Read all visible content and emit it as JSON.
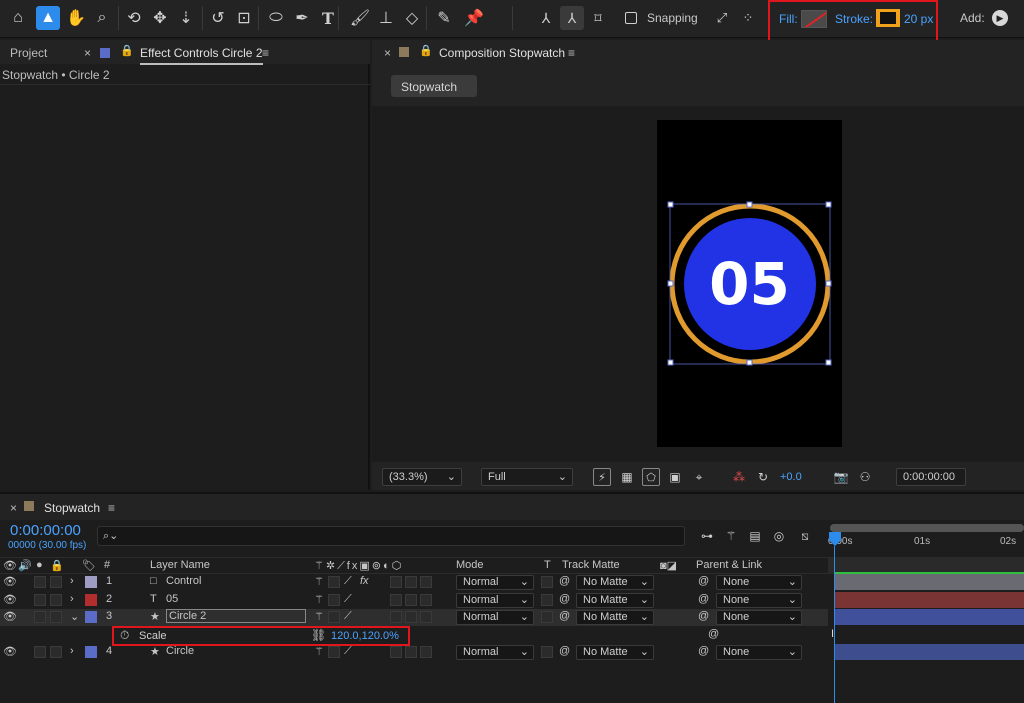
{
  "toolbar": {
    "tools": [
      {
        "name": "home-icon",
        "glyph": "⌂"
      },
      {
        "name": "selection-tool-icon",
        "glyph": "▲"
      },
      {
        "name": "hand-tool-icon",
        "glyph": "✋"
      },
      {
        "name": "zoom-tool-icon",
        "glyph": "⌕"
      },
      {
        "name": "orbit-camera-icon",
        "glyph": "⟲"
      },
      {
        "name": "pan-camera-icon",
        "glyph": "✥"
      },
      {
        "name": "dolly-camera-icon",
        "glyph": "⇣"
      },
      {
        "name": "rotation-tool-icon",
        "glyph": "↺"
      },
      {
        "name": "pan-behind-icon",
        "glyph": "⊡"
      },
      {
        "name": "ellipse-tool-icon",
        "glyph": "⬭"
      },
      {
        "name": "pen-tool-icon",
        "glyph": "✒"
      },
      {
        "name": "type-tool-icon",
        "glyph": "T"
      },
      {
        "name": "brush-tool-icon",
        "glyph": "🖌"
      },
      {
        "name": "clone-stamp-icon",
        "glyph": "⊥"
      },
      {
        "name": "eraser-tool-icon",
        "glyph": "◇"
      },
      {
        "name": "roto-brush-icon",
        "glyph": "✎"
      },
      {
        "name": "puppet-pin-icon",
        "glyph": "📌"
      }
    ],
    "axis_icons": [
      "⅄",
      "⅄",
      "⌑"
    ],
    "snapping_label": "Snapping",
    "fill_label": "Fill:",
    "stroke_label": "Stroke:",
    "stroke_width": "20 px",
    "add_label": "Add:",
    "stroke_color": "#f0a21d",
    "fill_color": "#c0392b"
  },
  "left_panel": {
    "project_tab": "Project",
    "effect_tab": "Effect Controls Circle 2",
    "breadcrumb": "Stopwatch • Circle 2",
    "effect_swatch": "#5a6bc8"
  },
  "comp_panel": {
    "tab": "Composition Stopwatch",
    "comp_button": "Stopwatch",
    "stopwatch_number": "05",
    "circle_color": "#2233e6",
    "ring_color": "#e09a2e",
    "zoom": "(33.3%)",
    "resolution": "Full",
    "exposure": "+0.0",
    "timecode": "0:00:00:00"
  },
  "timeline": {
    "tab": "Stopwatch",
    "current_time": "0:00:00:00",
    "frame_info": "00000 (30.00 fps)",
    "search_placeholder": "",
    "headers": {
      "hash": "#",
      "layer_name": "Layer Name",
      "mode": "Mode",
      "t": "T",
      "track_matte": "Track Matte",
      "parent_link": "Parent & Link"
    },
    "ruler": [
      "0:00s",
      "01s",
      "02s"
    ],
    "layers": [
      {
        "num": "1",
        "name": "Control",
        "color": "#9e9cc4",
        "type_glyph": "□",
        "mode": "Normal",
        "matte": "No Matte",
        "parent": "None",
        "bar_color": "#6a6a73",
        "has_fx": "fx"
      },
      {
        "num": "2",
        "name": "05",
        "color": "#b22e2e",
        "type_glyph": "T",
        "mode": "Normal",
        "matte": "No Matte",
        "parent": "None",
        "bar_color": "#7a3434",
        "has_fx": ""
      },
      {
        "num": "3",
        "name": "Circle 2",
        "color": "#5a6bc8",
        "type_glyph": "★",
        "mode": "Normal",
        "matte": "No Matte",
        "parent": "None",
        "bar_color": "#40509a",
        "has_fx": ""
      },
      {
        "num": "4",
        "name": "Circle",
        "color": "#5a6bc8",
        "type_glyph": "★",
        "mode": "Normal",
        "matte": "No Matte",
        "parent": "None",
        "bar_color": "#3e4d8e",
        "has_fx": ""
      }
    ],
    "scale_property": {
      "label": "Scale",
      "value": "120.0,120.0%"
    }
  }
}
